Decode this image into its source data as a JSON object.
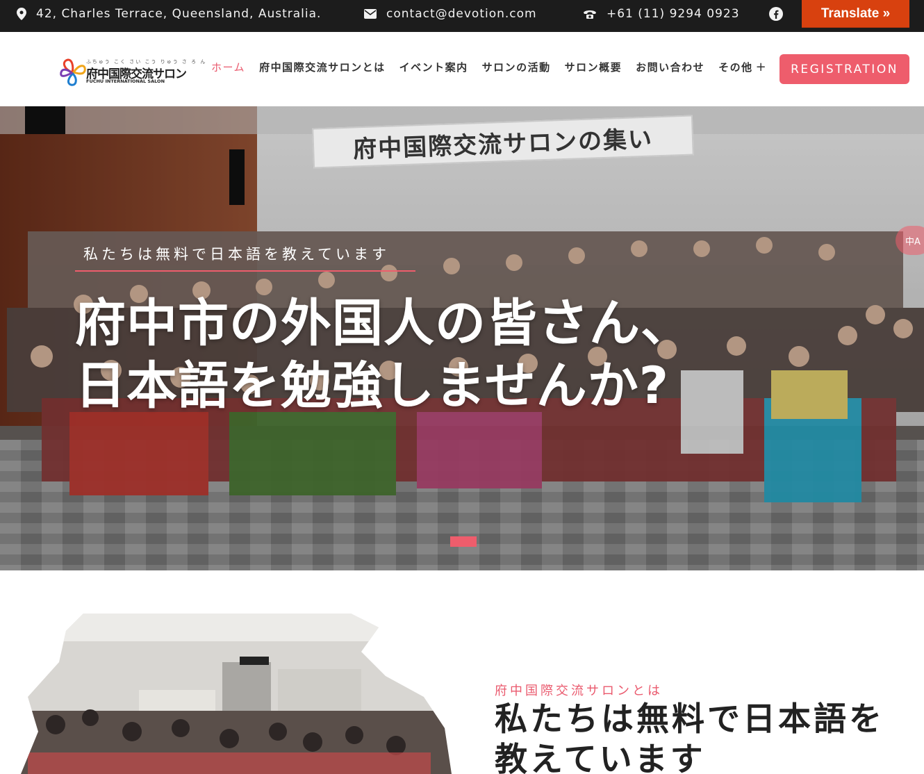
{
  "topbar": {
    "address": "42, Charles Terrace, Queensland, Australia.",
    "email": "contact@devotion.com",
    "phone": "+61 (11) 9294 0923",
    "social_icon": "facebook-icon",
    "translate_label": "Translate »"
  },
  "header": {
    "logo": {
      "ruby": "ふちゅう こく さい こう りゅう さ ろ ん",
      "name": "府中国際交流サロン",
      "english": "FUCHU INTERNATIONAL SALON"
    },
    "nav": [
      {
        "label": "ホーム",
        "active": true
      },
      {
        "label": "府中国際交流サロンとは"
      },
      {
        "label": "イベント案内"
      },
      {
        "label": "サロンの活動"
      },
      {
        "label": "サロン概要"
      },
      {
        "label": "お問い合わせ"
      },
      {
        "label": "その他",
        "expand": "+"
      }
    ],
    "register_label": "REGISTRATION"
  },
  "hero": {
    "banner_text": "府中国際交流サロンの集い",
    "subtitle": "私たちは無料で日本語を教えています",
    "title_line1": "府中市の外国人の皆さん、",
    "title_line2": "日本語を勉強しませんか?",
    "translate_float_label": "中A",
    "accent_color": "#ee5d6c"
  },
  "about": {
    "eyebrow": "府中国際交流サロンとは",
    "title": "私たちは無料で日本語を教えています"
  },
  "colors": {
    "topbar_bg": "#1c1c1c",
    "accent": "#ee5d6c",
    "translate_btn": "#d8410f"
  }
}
